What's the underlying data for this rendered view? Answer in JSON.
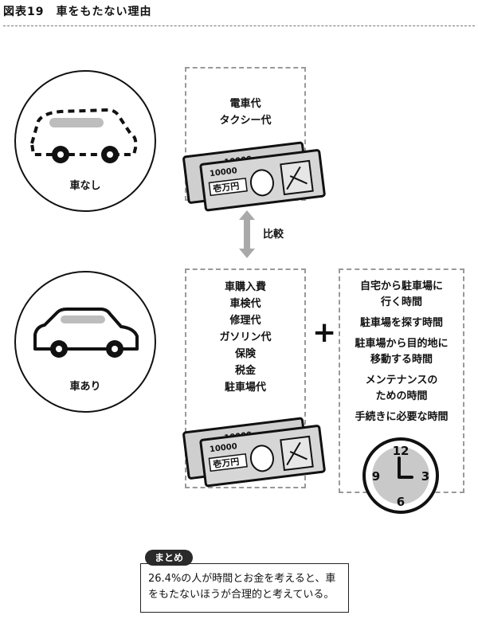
{
  "header": {
    "title": "図表19　車をもたない理由"
  },
  "no_car": {
    "label": "車なし"
  },
  "with_car": {
    "label": "車あり"
  },
  "no_car_costs": {
    "items": [
      "電車代",
      "タクシー代"
    ]
  },
  "compare_label": "比較",
  "car_costs": {
    "items": [
      "車購入費",
      "車検代",
      "修理代",
      "ガソリン代",
      "保険",
      "税金",
      "駐車場代"
    ]
  },
  "plus_sign": "+",
  "time_costs": {
    "items": [
      [
        "自宅から駐車場に",
        "行く時間"
      ],
      [
        "駐車場を探す時間"
      ],
      [
        "駐車場から目的地に",
        "移動する時間"
      ],
      [
        "メンテナンスの",
        "ための時間"
      ],
      [
        "手続きに必要な時間"
      ]
    ]
  },
  "banknote": {
    "denomination": "10000",
    "face_text": "壱万円"
  },
  "clock": {
    "n12": "12",
    "n3": "3",
    "n6": "6",
    "n9": "9"
  },
  "summary": {
    "tag": "まとめ",
    "line1": "26.4%の人が時間とお金を考えると、車",
    "line2": "をもたないほうが合理的と考えている。"
  }
}
